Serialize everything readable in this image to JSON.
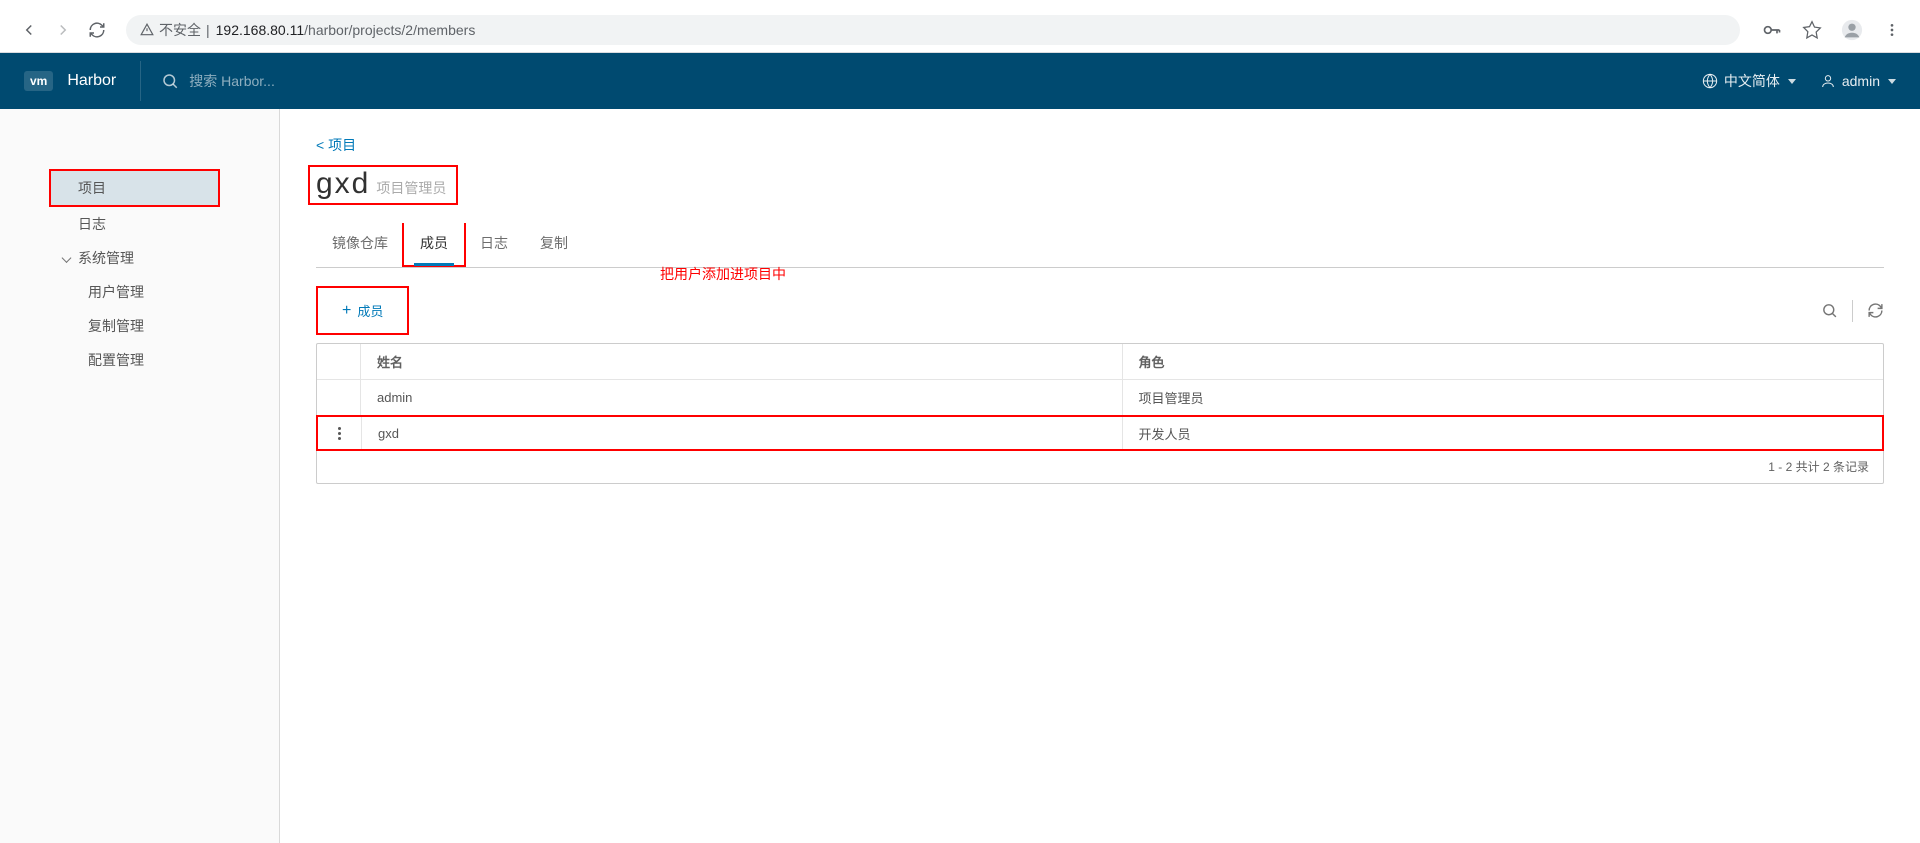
{
  "browser": {
    "tab_title": "Harbor",
    "security_label": "不安全",
    "url_host": "192.168.80.11",
    "url_path": "/harbor/projects/2/members"
  },
  "header": {
    "logo_badge": "vm",
    "title": "Harbor",
    "search_placeholder": "搜索 Harbor...",
    "language": "中文简体",
    "user": "admin"
  },
  "sidebar": {
    "items": {
      "projects": "项目",
      "logs": "日志",
      "system_admin": "系统管理",
      "user_mgmt": "用户管理",
      "replication_mgmt": "复制管理",
      "config_mgmt": "配置管理"
    }
  },
  "main": {
    "breadcrumb": "< 项目",
    "project_name": "gxd",
    "project_role_label": "项目管理员",
    "tabs": {
      "images": "镜像仓库",
      "members": "成员",
      "logs": "日志",
      "replication": "复制"
    },
    "annotation_text": "把用户添加进项目中",
    "add_member_label": "成员",
    "table": {
      "col_name": "姓名",
      "col_role": "角色",
      "rows": [
        {
          "name": "admin",
          "role": "项目管理员",
          "has_menu": false
        },
        {
          "name": "gxd",
          "role": "开发人员",
          "has_menu": true
        }
      ],
      "footer": "1 - 2 共计 2 条记录"
    }
  }
}
